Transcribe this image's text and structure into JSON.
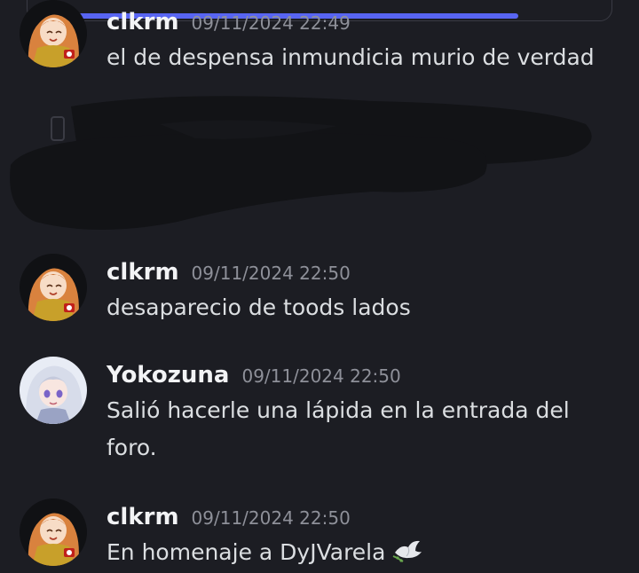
{
  "chat": {
    "progress": 0.91,
    "accent_color": "#5865f2",
    "messages": [
      {
        "username": "clkrm",
        "timestamp": "09/11/2024 22:49",
        "text": "el de despensa inmundicia murio de verdad",
        "avatar_icon": "anime-girl-avatar-icon"
      },
      {
        "username": "clkrm",
        "timestamp": "09/11/2024 22:50",
        "text": "desaparecio de toods lados",
        "avatar_icon": "anime-girl-avatar-icon"
      },
      {
        "username": "Yokozuna",
        "timestamp": "09/11/2024 22:50",
        "text": "Salió hacerle una lápida en la entrada del foro.",
        "avatar_icon": "white-hair-girl-avatar-icon"
      },
      {
        "username": "clkrm",
        "timestamp": "09/11/2024 22:50",
        "text": "En homenaje a DyJVarela",
        "emoji_icon": "dove-icon",
        "avatar_icon": "anime-girl-avatar-icon"
      }
    ]
  }
}
